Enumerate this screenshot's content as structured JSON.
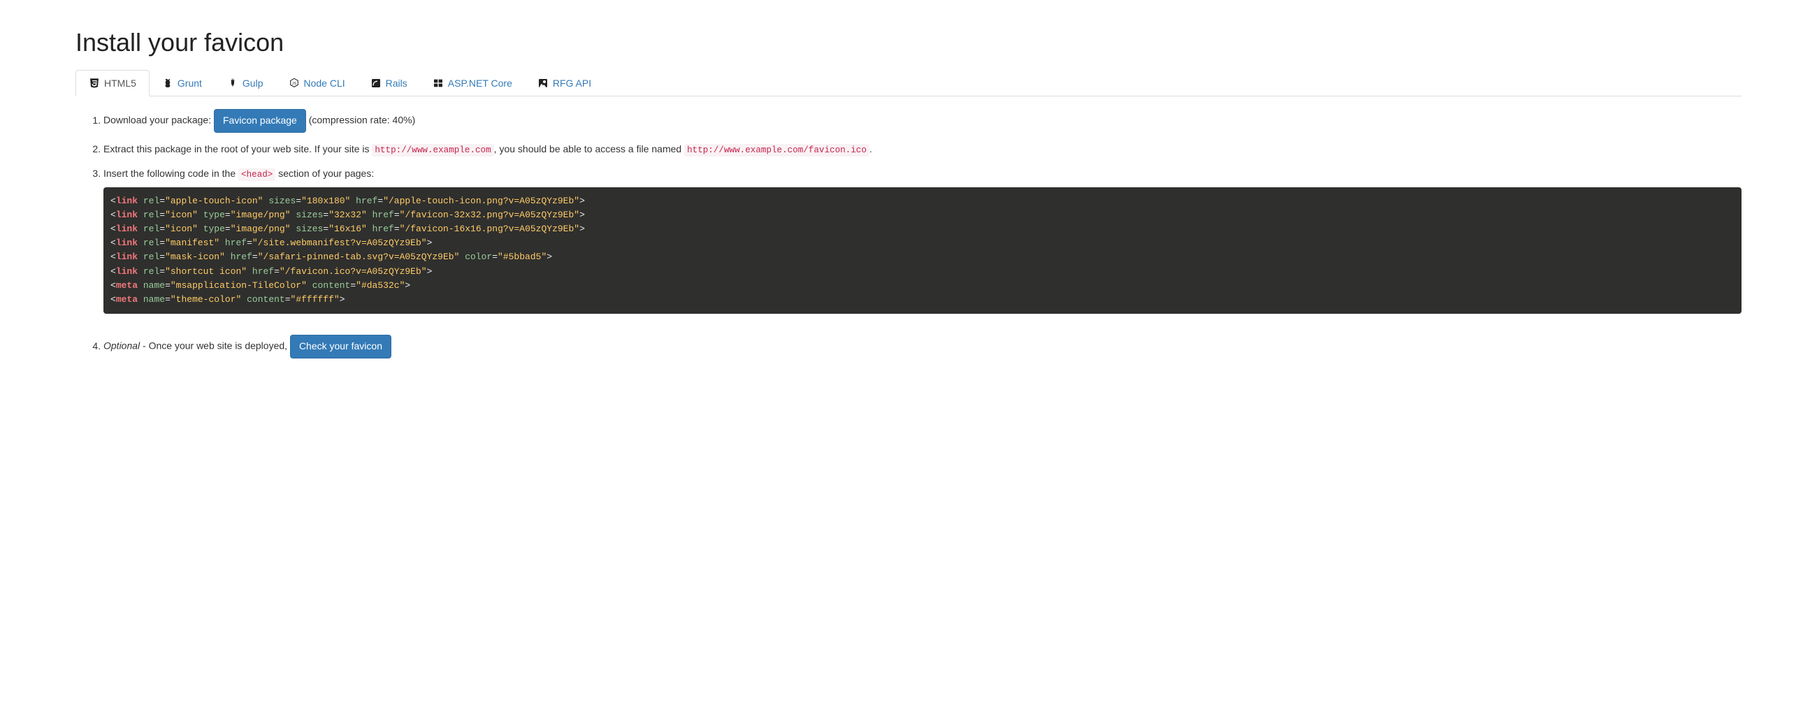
{
  "title": "Install your favicon",
  "tabs": {
    "html5": "HTML5",
    "grunt": "Grunt",
    "gulp": "Gulp",
    "node": "Node CLI",
    "rails": "Rails",
    "aspnet": "ASP.NET Core",
    "rfg": "RFG API"
  },
  "step1": {
    "prefix": "Download your package: ",
    "button": "Favicon package",
    "suffix": " (compression rate: 40%)"
  },
  "step2": {
    "t1": "Extract this package in the root of your web site. If your site is ",
    "code1": "http://www.example.com",
    "t2": ", you should be able to access a file named ",
    "code2": "http://www.example.com/favicon.ico",
    "t3": "."
  },
  "step3": {
    "t1": "Insert the following code in the ",
    "code": "<head>",
    "t2": " section of your pages:"
  },
  "code_lines": [
    {
      "tag": "link",
      "attrs": [
        [
          "rel",
          "apple-touch-icon"
        ],
        [
          "sizes",
          "180x180"
        ],
        [
          "href",
          "/apple-touch-icon.png?v=A05zQYz9Eb"
        ]
      ]
    },
    {
      "tag": "link",
      "attrs": [
        [
          "rel",
          "icon"
        ],
        [
          "type",
          "image/png"
        ],
        [
          "sizes",
          "32x32"
        ],
        [
          "href",
          "/favicon-32x32.png?v=A05zQYz9Eb"
        ]
      ]
    },
    {
      "tag": "link",
      "attrs": [
        [
          "rel",
          "icon"
        ],
        [
          "type",
          "image/png"
        ],
        [
          "sizes",
          "16x16"
        ],
        [
          "href",
          "/favicon-16x16.png?v=A05zQYz9Eb"
        ]
      ]
    },
    {
      "tag": "link",
      "attrs": [
        [
          "rel",
          "manifest"
        ],
        [
          "href",
          "/site.webmanifest?v=A05zQYz9Eb"
        ]
      ]
    },
    {
      "tag": "link",
      "attrs": [
        [
          "rel",
          "mask-icon"
        ],
        [
          "href",
          "/safari-pinned-tab.svg?v=A05zQYz9Eb"
        ],
        [
          "color",
          "#5bbad5"
        ]
      ]
    },
    {
      "tag": "link",
      "attrs": [
        [
          "rel",
          "shortcut icon"
        ],
        [
          "href",
          "/favicon.ico?v=A05zQYz9Eb"
        ]
      ]
    },
    {
      "tag": "meta",
      "attrs": [
        [
          "name",
          "msapplication-TileColor"
        ],
        [
          "content",
          "#da532c"
        ]
      ]
    },
    {
      "tag": "meta",
      "attrs": [
        [
          "name",
          "theme-color"
        ],
        [
          "content",
          "#ffffff"
        ]
      ]
    }
  ],
  "step4": {
    "optional": "Optional",
    "t1": " - Once your web site is deployed, ",
    "button": "Check your favicon"
  }
}
